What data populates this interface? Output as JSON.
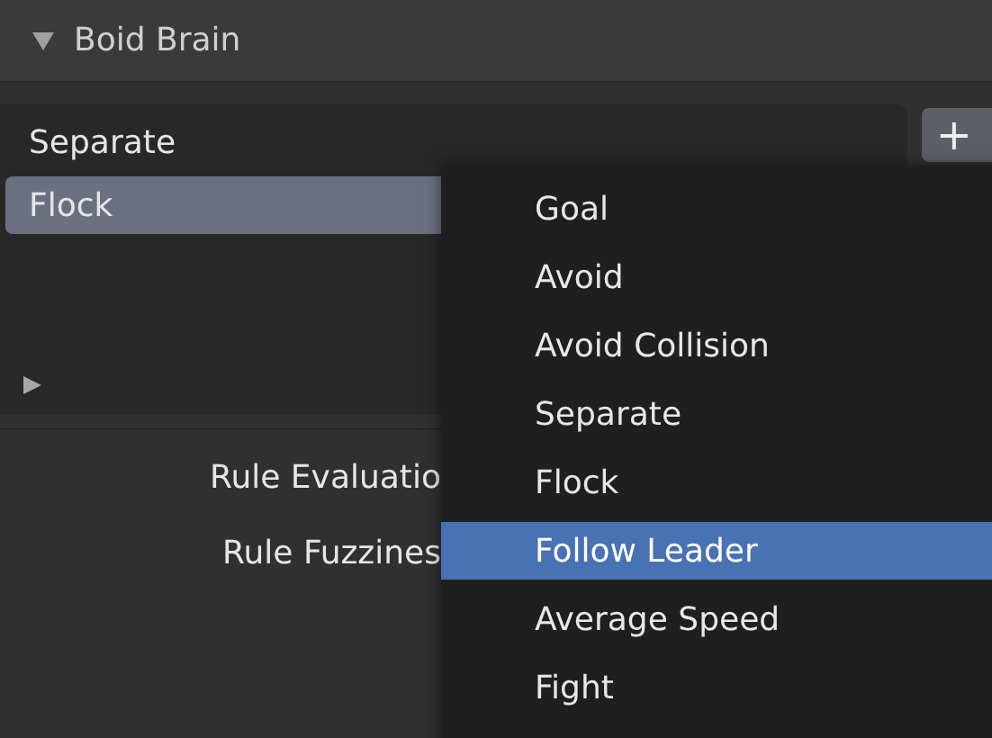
{
  "panel": {
    "title": "Boid Brain",
    "expanded": true
  },
  "rule_list": {
    "items": [
      {
        "label": "Separate",
        "selected": false
      },
      {
        "label": "Flock",
        "selected": true
      }
    ]
  },
  "add_button": {
    "label": "+"
  },
  "properties": [
    {
      "label": "Rule Evaluatio"
    },
    {
      "label": "Rule Fuzzines"
    }
  ],
  "menu": {
    "items": [
      {
        "label": "Goal",
        "selected": false
      },
      {
        "label": "Avoid",
        "selected": false
      },
      {
        "label": "Avoid Collision",
        "selected": false
      },
      {
        "label": "Separate",
        "selected": false
      },
      {
        "label": "Flock",
        "selected": false
      },
      {
        "label": "Follow Leader",
        "selected": true
      },
      {
        "label": "Average Speed",
        "selected": false
      },
      {
        "label": "Fight",
        "selected": false
      }
    ]
  }
}
